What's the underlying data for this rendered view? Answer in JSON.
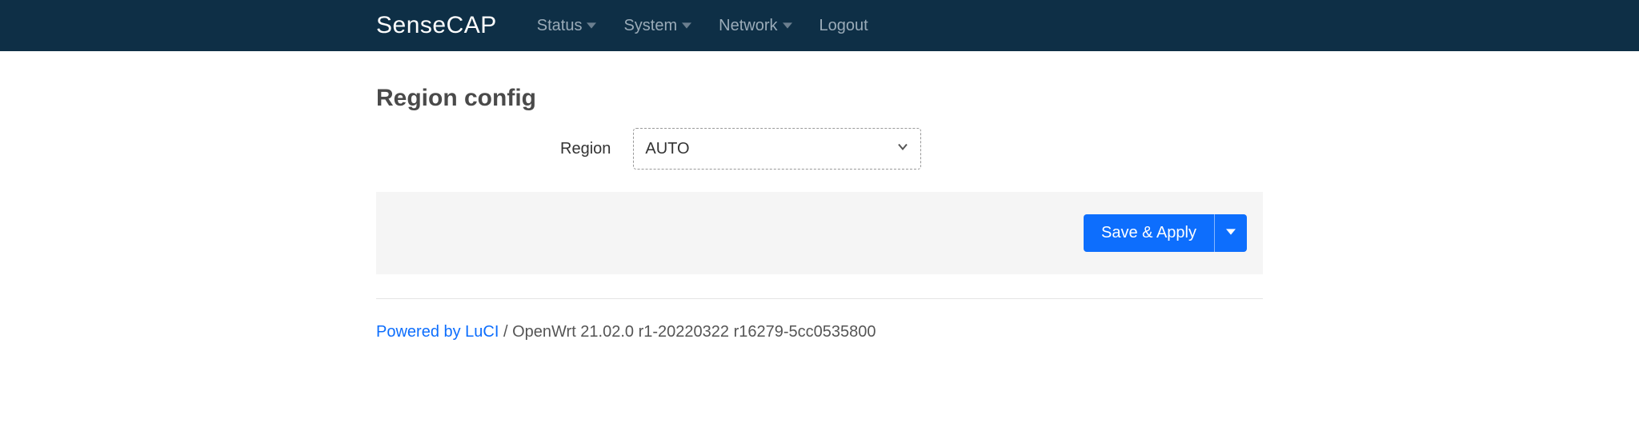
{
  "header": {
    "brand": "SenseCAP",
    "nav": {
      "status": "Status",
      "system": "System",
      "network": "Network",
      "logout": "Logout"
    }
  },
  "page": {
    "title": "Region config"
  },
  "form": {
    "region_label": "Region",
    "region_value": "AUTO"
  },
  "actions": {
    "save_apply": "Save & Apply"
  },
  "footer": {
    "link_text": "Powered by LuCI",
    "separator": " / ",
    "version": "OpenWrt 21.02.0 r1-20220322 r16279-5cc0535800"
  }
}
